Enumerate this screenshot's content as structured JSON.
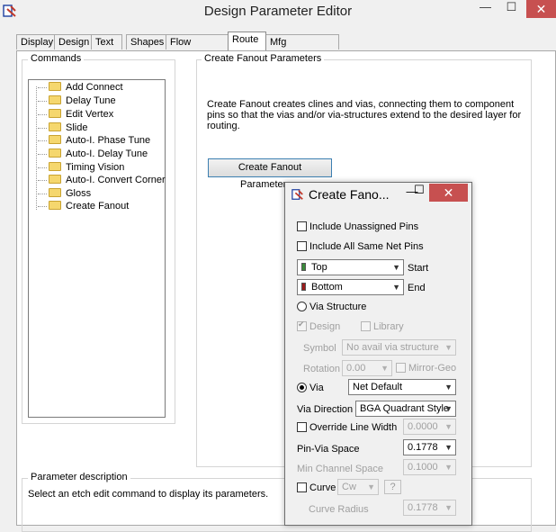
{
  "window": {
    "title": "Design Parameter Editor"
  },
  "tabs": [
    {
      "label": "Display"
    },
    {
      "label": "Design"
    },
    {
      "label": "Text"
    },
    {
      "label": "Shapes"
    },
    {
      "label": "Flow Planning"
    },
    {
      "label": "Route"
    },
    {
      "label": "Mfg Applications"
    }
  ],
  "active_tab": "Route",
  "commands": {
    "label": "Commands",
    "items": [
      {
        "label": "Add Connect"
      },
      {
        "label": "Delay Tune"
      },
      {
        "label": "Edit Vertex"
      },
      {
        "label": "Slide"
      },
      {
        "label": "Auto-I. Phase Tune"
      },
      {
        "label": "Auto-I. Delay Tune"
      },
      {
        "label": "Timing Vision"
      },
      {
        "label": "Auto-I. Convert Corner"
      },
      {
        "label": "Gloss"
      },
      {
        "label": "Create Fanout"
      }
    ]
  },
  "params": {
    "label": "Create Fanout Parameters",
    "description": "Create Fanout creates clines and vias, connecting them to component pins so that the vias and/or via-structures extend to the desired layer for routing.",
    "button": "Create Fanout Parameters..."
  },
  "param_desc": {
    "label": "Parameter description",
    "text": "Select an etch edit command to display its parameters."
  },
  "dialog": {
    "title": "Create Fano...",
    "include_unassigned": "Include Unassigned Pins",
    "include_same_net": "Include All Same Net Pins",
    "start_layer": "Top",
    "start_label": "Start",
    "start_color": "#3a8a3a",
    "end_layer": "Bottom",
    "end_label": "End",
    "end_color": "#9a1b1b",
    "via_structure": "Via Structure",
    "design": "Design",
    "library": "Library",
    "symbol_label": "Symbol",
    "symbol_value": "No avail via structure",
    "rotation_label": "Rotation",
    "rotation_value": "0.00",
    "mirror_geo": "Mirror-Geo",
    "via": "Via",
    "via_value": "Net Default",
    "via_direction_label": "Via Direction",
    "via_direction_value": "BGA Quadrant Style",
    "override_line_width": "Override Line Width",
    "line_width_value": "0.0000",
    "pin_via_space_label": "Pin-Via Space",
    "pin_via_space_value": "0.1778",
    "min_channel_label": "Min Channel Space",
    "min_channel_value": "0.1000",
    "curve": "Curve",
    "curve_dir": "Cw",
    "help": "?",
    "curve_radius_label": "Curve Radius",
    "curve_radius_value": "0.1778"
  }
}
